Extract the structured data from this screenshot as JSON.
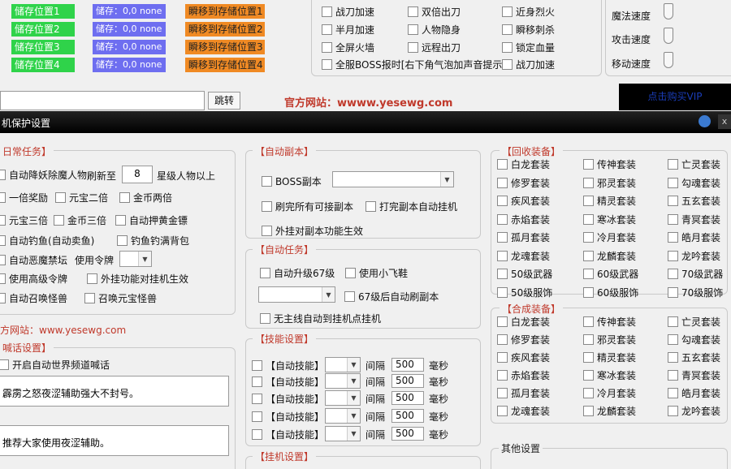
{
  "top": {
    "storage_positions": [
      "储存位置1",
      "储存位置2",
      "储存位置3",
      "储存位置4"
    ],
    "storage_values": [
      "储存：0,0  none",
      "储存：0,0  none",
      "储存：0,0  none",
      "储存：0,0  none"
    ],
    "teleport_buttons": [
      "瞬移到存储位置1",
      "瞬移到存储位置2",
      "瞬移到存储位置3",
      "瞬移到存储位置4"
    ],
    "options": [
      {
        "label": "战刀加速"
      },
      {
        "label": "双倍出刀"
      },
      {
        "label": "近身烈火"
      },
      {
        "label": "半月加速"
      },
      {
        "label": "人物隐身"
      },
      {
        "label": "瞬移刺杀"
      },
      {
        "label": "全屏火墙"
      },
      {
        "label": "远程出刀"
      },
      {
        "label": "锁定血量"
      },
      {
        "label": "全服BOSS报时[右下角气泡加声音提示]"
      },
      {
        "label": "战刀加速"
      }
    ],
    "speed_labels": [
      "魔法速度",
      "攻击速度",
      "移动速度"
    ],
    "jump_button": "跳转",
    "official_site": "官方网站：wwww.yesewg.com",
    "buy_vip": "点击购买VIP"
  },
  "window": {
    "title": "机保护设置"
  },
  "daily": {
    "title": "日常任务】",
    "kill_label": "自动降妖除魔人物",
    "refresh_to": "刷新至",
    "level_value": "8",
    "level_suffix": "星级人物以上",
    "double_reward": "一倍奖励",
    "yuanbao_double": "元宝二倍",
    "gold_double": "金币两倍",
    "yuanbao_triple": "元宝三倍",
    "gold_triple": "金币三倍",
    "auto_escort": "自动押黄金镖",
    "auto_fish": "自动钓鱼(自动卖鱼)",
    "fish_full": "钓鱼钓满背包",
    "auto_evil": "自动恶魔禁坛",
    "use_token": "使用令牌",
    "use_high_token": "使用高级令牌",
    "offline_effect": "外挂功能对挂机生效",
    "summon_monster": "自动召唤怪兽",
    "summon_yuanbao": "召唤元宝怪兽"
  },
  "website_text": "方网站：www.yesewg.com",
  "shout": {
    "title": "喊话设置】",
    "auto_world": "开启自动世界频道喊话",
    "message1": "霹雳之怒夜涩辅助强大不封号。",
    "message2": "推荐大家使用夜涩辅助。"
  },
  "dungeon": {
    "title": "【自动副本】",
    "boss_label": "BOSS副本",
    "refresh_all": "刷完所有可接副本",
    "auto_hang": "打完副本自动挂机",
    "offline_effect": "外挂对副本功能生效"
  },
  "auto_task": {
    "title": "【自动任务】",
    "upgrade_67": "自动升级67级",
    "use_plane": "使用小飞鞋",
    "after_67": "67级后自动刷副本",
    "no_main": "无主线自动到挂机点挂机"
  },
  "skills": {
    "title": "【技能设置】",
    "rows": [
      {
        "label": "【自动技能】",
        "interval": "间隔",
        "value": "500",
        "unit": "毫秒"
      },
      {
        "label": "【自动技能】",
        "interval": "间隔",
        "value": "500",
        "unit": "毫秒"
      },
      {
        "label": "【自动技能】",
        "interval": "间隔",
        "value": "500",
        "unit": "毫秒"
      },
      {
        "label": "【自动技能】",
        "interval": "间隔",
        "value": "500",
        "unit": "毫秒"
      },
      {
        "label": "【自动技能】",
        "interval": "间隔",
        "value": "500",
        "unit": "毫秒"
      }
    ]
  },
  "hangup": {
    "title": "【挂机设置】"
  },
  "recycle": {
    "title": "【回收装备】",
    "items": [
      "白龙套装",
      "传神套装",
      "亡灵套装",
      "修罗套装",
      "邪灵套装",
      "勾魂套装",
      "疾风套装",
      "精灵套装",
      "五玄套装",
      "赤焰套装",
      "寒冰套装",
      "青冥套装",
      "孤月套装",
      "冷月套装",
      "皓月套装",
      "龙魂套装",
      "龙麟套装",
      "龙吟套装",
      "50级武器",
      "60级武器",
      "70级武器",
      "50级服饰",
      "60级服饰",
      "70级服饰"
    ]
  },
  "synth": {
    "title": "【合成装备】",
    "items": [
      "白龙套装",
      "传神套装",
      "亡灵套装",
      "修罗套装",
      "邪灵套装",
      "勾魂套装",
      "疾风套装",
      "精灵套装",
      "五玄套装",
      "赤焰套装",
      "寒冰套装",
      "青冥套装",
      "孤月套装",
      "冷月套装",
      "皓月套装",
      "龙魂套装",
      "龙麟套装",
      "龙吟套装"
    ]
  },
  "other": {
    "title": "其他设置"
  }
}
